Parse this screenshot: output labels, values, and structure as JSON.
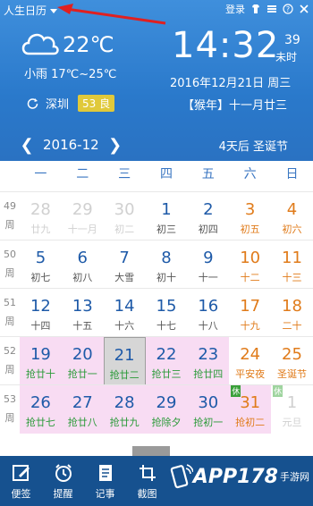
{
  "header": {
    "app_title": "人生日历",
    "login_label": "登录",
    "weather": {
      "temp": "22℃",
      "range": "小雨 17℃~25℃",
      "city": "深圳",
      "aqi_value": "53",
      "aqi_label": "良"
    },
    "clock": {
      "time": "14:32",
      "seconds": "39",
      "seconds_unit": "未时"
    },
    "date_line": "2016年12月21日  周三",
    "lunar_line": "【猴年】十一月廿三",
    "month_label": "2016-12",
    "festival_countdown": "4天后  圣诞节"
  },
  "weekday_headers": [
    "一",
    "二",
    "三",
    "四",
    "五",
    "六",
    "日"
  ],
  "weeks": [
    {
      "num": "49",
      "unit": "周",
      "days": [
        {
          "d": "28",
          "l": "廿九",
          "t": "other"
        },
        {
          "d": "29",
          "l": "十一月",
          "t": "other"
        },
        {
          "d": "30",
          "l": "初二",
          "t": "other"
        },
        {
          "d": "1",
          "l": "初三",
          "t": "work"
        },
        {
          "d": "2",
          "l": "初四",
          "t": "work"
        },
        {
          "d": "3",
          "l": "初五",
          "t": "weekend"
        },
        {
          "d": "4",
          "l": "初六",
          "t": "weekend"
        }
      ]
    },
    {
      "num": "50",
      "unit": "周",
      "days": [
        {
          "d": "5",
          "l": "初七",
          "t": "work"
        },
        {
          "d": "6",
          "l": "初八",
          "t": "work"
        },
        {
          "d": "7",
          "l": "大雪",
          "t": "work",
          "term": true
        },
        {
          "d": "8",
          "l": "初十",
          "t": "work"
        },
        {
          "d": "9",
          "l": "十一",
          "t": "work"
        },
        {
          "d": "10",
          "l": "十二",
          "t": "weekend"
        },
        {
          "d": "11",
          "l": "十三",
          "t": "weekend"
        }
      ]
    },
    {
      "num": "51",
      "unit": "周",
      "days": [
        {
          "d": "12",
          "l": "十四",
          "t": "work"
        },
        {
          "d": "13",
          "l": "十五",
          "t": "work"
        },
        {
          "d": "14",
          "l": "十六",
          "t": "work"
        },
        {
          "d": "15",
          "l": "十七",
          "t": "work"
        },
        {
          "d": "16",
          "l": "十八",
          "t": "work"
        },
        {
          "d": "17",
          "l": "十九",
          "t": "weekend"
        },
        {
          "d": "18",
          "l": "二十",
          "t": "weekend"
        }
      ]
    },
    {
      "num": "52",
      "unit": "周",
      "days": [
        {
          "d": "19",
          "l": "抢廿十",
          "t": "work",
          "hl": true
        },
        {
          "d": "20",
          "l": "抢廿一",
          "t": "work",
          "hl": true
        },
        {
          "d": "21",
          "l": "抢廿二",
          "t": "work",
          "hl": true,
          "today": true
        },
        {
          "d": "22",
          "l": "抢廿三",
          "t": "work",
          "hl": true
        },
        {
          "d": "23",
          "l": "抢廿四",
          "t": "work",
          "hl": true
        },
        {
          "d": "24",
          "l": "平安夜",
          "t": "weekend"
        },
        {
          "d": "25",
          "l": "圣诞节",
          "t": "weekend"
        }
      ]
    },
    {
      "num": "53",
      "unit": "周",
      "days": [
        {
          "d": "26",
          "l": "抢廿七",
          "t": "work",
          "hl": true
        },
        {
          "d": "27",
          "l": "抢廿八",
          "t": "work",
          "hl": true
        },
        {
          "d": "28",
          "l": "抢廿九",
          "t": "work",
          "hl": true
        },
        {
          "d": "29",
          "l": "抢除夕",
          "t": "work",
          "hl": true
        },
        {
          "d": "30",
          "l": "抢初一",
          "t": "work",
          "hl": true
        },
        {
          "d": "31",
          "l": "抢初二",
          "t": "weekend",
          "hl": true,
          "badge": "休"
        },
        {
          "d": "1",
          "l": "元旦",
          "t": "other",
          "badge": "休"
        }
      ]
    }
  ],
  "toolbar": [
    {
      "label": "便签",
      "icon": "note-pen-icon"
    },
    {
      "label": "提醒",
      "icon": "alarm-clock-icon"
    },
    {
      "label": "记事",
      "icon": "notebook-icon"
    },
    {
      "label": "截图",
      "icon": "screenshot-icon"
    }
  ],
  "watermark": {
    "text": "APP178",
    "sub": "手游网"
  }
}
